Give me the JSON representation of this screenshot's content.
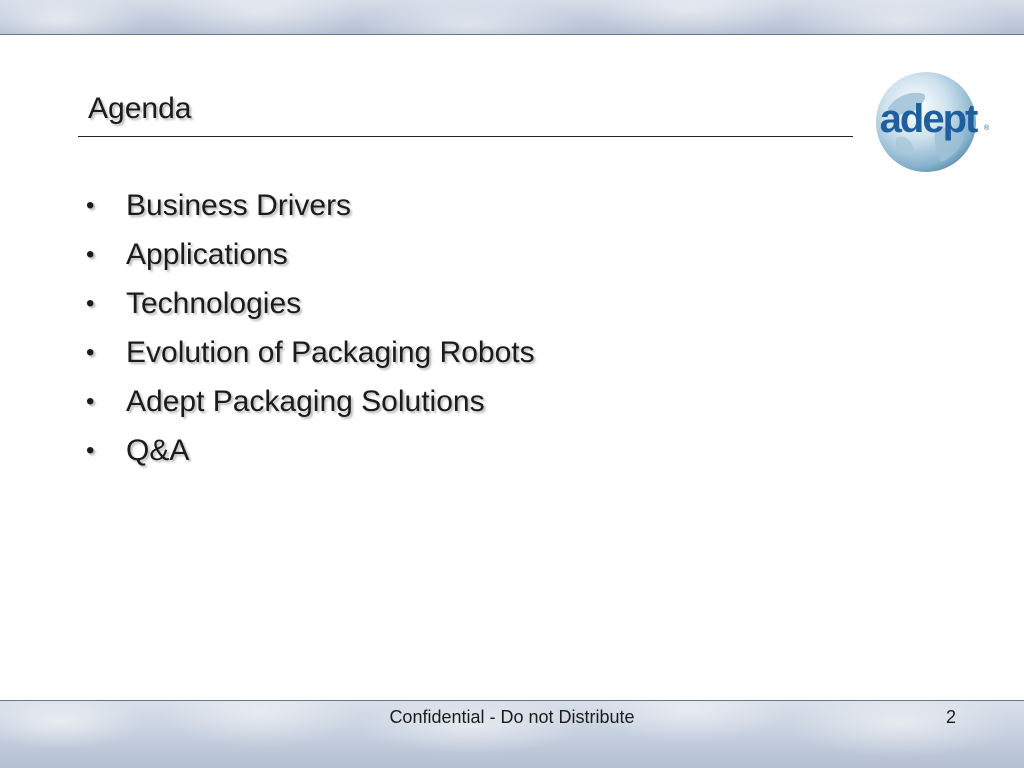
{
  "slide": {
    "title": "Agenda",
    "bullets": [
      "Business Drivers",
      "Applications",
      "Technologies",
      "Evolution of Packaging Robots",
      "Adept Packaging Solutions",
      "Q&A"
    ],
    "bullet_glyph": "•"
  },
  "logo": {
    "text": "adept",
    "trademark": "®",
    "icon": "globe-logo-icon"
  },
  "footer": {
    "confidential": "Confidential - Do not Distribute",
    "page_number": "2"
  },
  "colors": {
    "text": "#1b1b1b",
    "logo_blue": "#1f5f9e",
    "band": "#c3cddd"
  }
}
